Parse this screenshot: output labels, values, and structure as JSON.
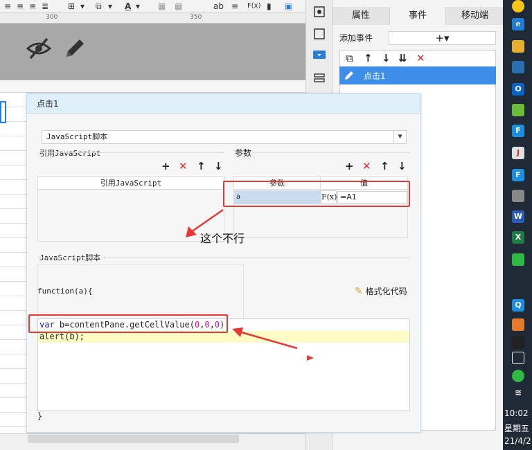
{
  "toolbar": {
    "items": [
      "≡",
      "≡",
      "≡",
      "≣",
      "⊞",
      "▾",
      "⧉",
      "▾",
      "A",
      "▾",
      "▦",
      "▦",
      "ab",
      "≡",
      "F(x)",
      "▮",
      "▣"
    ]
  },
  "ruler": {
    "ticks": [
      "300",
      "350"
    ]
  },
  "right_panel": {
    "tabs": [
      "属性",
      "事件",
      "移动端"
    ],
    "add_event_label": "添加事件",
    "add_event_button": "+▾",
    "event_name": "点击1"
  },
  "dialog": {
    "title": "点击1",
    "type_select": "JavaScript脚本",
    "ref_section": "引用JavaScript",
    "params_section": "参数",
    "ref_column": "引用JavaScript",
    "param_col_name": "参数",
    "param_col_value": "值",
    "param_name": "a",
    "param_fx": "F(x)",
    "param_value": "=A1",
    "annotation": "这个不行",
    "script_section": "JavaScript脚本",
    "function_signature": "function(a){",
    "format_button": "格式化代码",
    "code_line1_kw": "var",
    "code_line1_rest": " b=contentPane.getCellValue(",
    "code_line1_num1": "0",
    "code_line1_comma1": ",",
    "code_line1_num2": "0",
    "code_line1_comma2": ",",
    "code_line1_num3": "0",
    "code_line1_end": ");",
    "code_line2": "alert(b);",
    "function_close": "}"
  },
  "taskbar": {
    "time": "10:02",
    "weekday": "星期五",
    "date": "21/4/2"
  },
  "colors": {
    "accent_blue": "#3d8ee8",
    "dialog_title_bg": "#dff0fb",
    "highlight_red": "#e53935",
    "code_keyword": "#1818b0",
    "code_number": "#c01890"
  }
}
